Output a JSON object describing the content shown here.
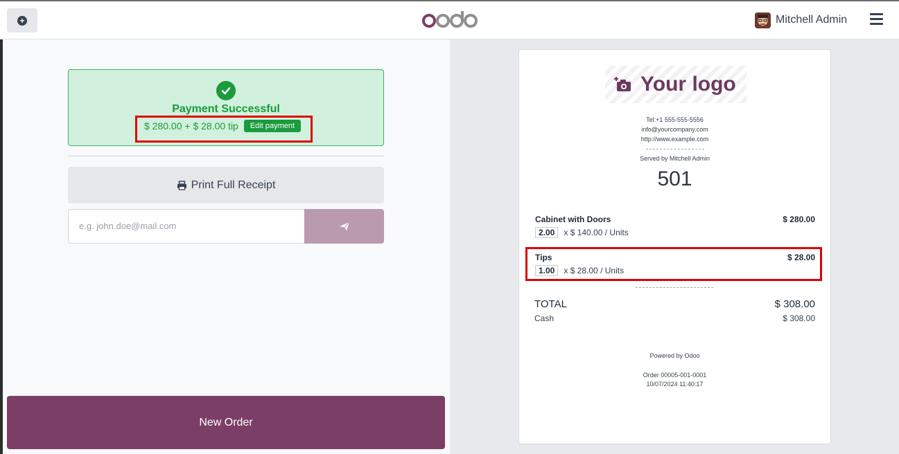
{
  "topbar": {
    "brand": "odoo",
    "user_name": "Mitchell Admin"
  },
  "payment": {
    "title": "Payment Successful",
    "amount_text": "$ 280.00 + $ 28.00 tip",
    "edit_label": "Edit payment"
  },
  "actions": {
    "print_label": "Print Full Receipt",
    "email_placeholder": "e.g. john.doe@mail.com",
    "new_order_label": "New Order"
  },
  "receipt": {
    "logo_text": "Your logo",
    "tel": "Tel:+1 555-555-5556",
    "email": "info@yourcompany.com",
    "website": "http://www.example.com",
    "served_by": "Served by Mitchell Admin",
    "order_number": "501",
    "lines": [
      {
        "name": "Cabinet with Doors",
        "price": "$ 280.00",
        "qty": "2.00",
        "unit_text": "x $ 140.00 / Units"
      },
      {
        "name": "Tips",
        "price": "$ 28.00",
        "qty": "1.00",
        "unit_text": "x $ 28.00 / Units"
      }
    ],
    "total_label": "TOTAL",
    "total_value": "$ 308.00",
    "cash_label": "Cash",
    "cash_value": "$ 308.00",
    "powered_by": "Powered by Odoo",
    "order_ref": "Order 00005-001-0001",
    "datetime": "10/07/2024 11:40:17"
  },
  "colors": {
    "brand": "#7b3f67",
    "success": "#1a9b3c",
    "highlight": "#e00000"
  }
}
